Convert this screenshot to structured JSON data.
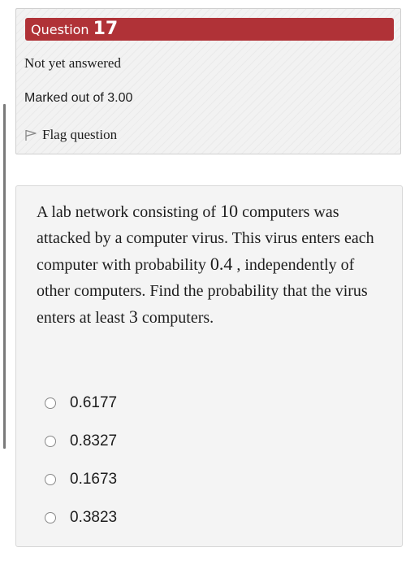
{
  "info": {
    "question_word": "Question",
    "question_number": "17",
    "state": "Not yet answered",
    "grade": "Marked out of 3.00",
    "flag_label": "Flag question"
  },
  "question": {
    "text_1": "A lab network consisting of ",
    "n": "10",
    "text_2": " computers was attacked by a computer virus. This virus enters each computer with probability ",
    "p": "0.4",
    "text_3": " , independently of other computers. Find the probability that the virus enters at least ",
    "k": "3",
    "text_4": " computers."
  },
  "answers": [
    {
      "label": "0.6177"
    },
    {
      "label": "0.8327"
    },
    {
      "label": "0.1673"
    },
    {
      "label": "0.3823"
    }
  ],
  "colors": {
    "header_bg": "#b03237",
    "card_bg": "#f4f4f4"
  }
}
